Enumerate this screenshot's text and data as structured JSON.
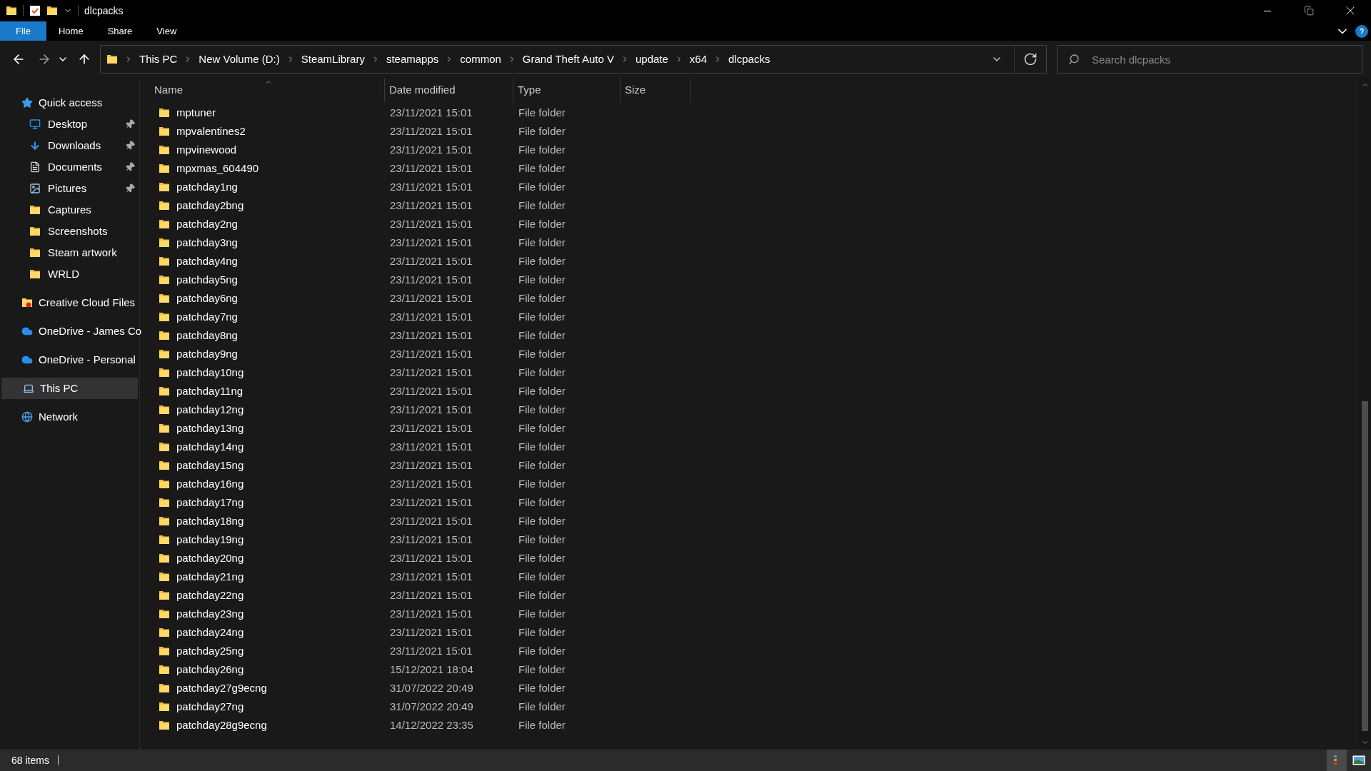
{
  "window": {
    "title": "dlcpacks"
  },
  "ribbon_tabs": [
    {
      "label": "File",
      "selected": true
    },
    {
      "label": "Home",
      "selected": false
    },
    {
      "label": "Share",
      "selected": false
    },
    {
      "label": "View",
      "selected": false
    }
  ],
  "breadcrumb": [
    "This PC",
    "New Volume (D:)",
    "SteamLibrary",
    "steamapps",
    "common",
    "Grand Theft Auto V",
    "update",
    "x64",
    "dlcpacks"
  ],
  "search": {
    "placeholder": "Search dlcpacks"
  },
  "sidebar": {
    "items": [
      {
        "label": "Quick access",
        "kind": "star",
        "selected": false,
        "children": [
          {
            "label": "Desktop",
            "kind": "desktop",
            "pinned": true
          },
          {
            "label": "Downloads",
            "kind": "download",
            "pinned": true
          },
          {
            "label": "Documents",
            "kind": "document",
            "pinned": true
          },
          {
            "label": "Pictures",
            "kind": "picture",
            "pinned": true
          },
          {
            "label": "Captures",
            "kind": "folder",
            "pinned": false
          },
          {
            "label": "Screenshots",
            "kind": "folder",
            "pinned": false
          },
          {
            "label": "Steam artwork",
            "kind": "folder",
            "pinned": false
          },
          {
            "label": "WRLD",
            "kind": "folder",
            "pinned": false
          }
        ]
      },
      {
        "label": "Creative Cloud Files",
        "kind": "cloud-folder",
        "selected": false
      },
      {
        "label": "OneDrive - James Co",
        "kind": "cloud",
        "selected": false
      },
      {
        "label": "OneDrive - Personal",
        "kind": "cloud",
        "selected": false
      },
      {
        "label": "This PC",
        "kind": "pc",
        "selected": true
      },
      {
        "label": "Network",
        "kind": "network",
        "selected": false
      }
    ]
  },
  "table": {
    "columns": [
      "Name",
      "Date modified",
      "Type",
      "Size"
    ],
    "rows": [
      {
        "name": "mptuner",
        "date": "23/11/2021 15:01",
        "type": "File folder"
      },
      {
        "name": "mpvalentines2",
        "date": "23/11/2021 15:01",
        "type": "File folder"
      },
      {
        "name": "mpvinewood",
        "date": "23/11/2021 15:01",
        "type": "File folder"
      },
      {
        "name": "mpxmas_604490",
        "date": "23/11/2021 15:01",
        "type": "File folder"
      },
      {
        "name": "patchday1ng",
        "date": "23/11/2021 15:01",
        "type": "File folder"
      },
      {
        "name": "patchday2bng",
        "date": "23/11/2021 15:01",
        "type": "File folder"
      },
      {
        "name": "patchday2ng",
        "date": "23/11/2021 15:01",
        "type": "File folder"
      },
      {
        "name": "patchday3ng",
        "date": "23/11/2021 15:01",
        "type": "File folder"
      },
      {
        "name": "patchday4ng",
        "date": "23/11/2021 15:01",
        "type": "File folder"
      },
      {
        "name": "patchday5ng",
        "date": "23/11/2021 15:01",
        "type": "File folder"
      },
      {
        "name": "patchday6ng",
        "date": "23/11/2021 15:01",
        "type": "File folder"
      },
      {
        "name": "patchday7ng",
        "date": "23/11/2021 15:01",
        "type": "File folder"
      },
      {
        "name": "patchday8ng",
        "date": "23/11/2021 15:01",
        "type": "File folder"
      },
      {
        "name": "patchday9ng",
        "date": "23/11/2021 15:01",
        "type": "File folder"
      },
      {
        "name": "patchday10ng",
        "date": "23/11/2021 15:01",
        "type": "File folder"
      },
      {
        "name": "patchday11ng",
        "date": "23/11/2021 15:01",
        "type": "File folder"
      },
      {
        "name": "patchday12ng",
        "date": "23/11/2021 15:01",
        "type": "File folder"
      },
      {
        "name": "patchday13ng",
        "date": "23/11/2021 15:01",
        "type": "File folder"
      },
      {
        "name": "patchday14ng",
        "date": "23/11/2021 15:01",
        "type": "File folder"
      },
      {
        "name": "patchday15ng",
        "date": "23/11/2021 15:01",
        "type": "File folder"
      },
      {
        "name": "patchday16ng",
        "date": "23/11/2021 15:01",
        "type": "File folder"
      },
      {
        "name": "patchday17ng",
        "date": "23/11/2021 15:01",
        "type": "File folder"
      },
      {
        "name": "patchday18ng",
        "date": "23/11/2021 15:01",
        "type": "File folder"
      },
      {
        "name": "patchday19ng",
        "date": "23/11/2021 15:01",
        "type": "File folder"
      },
      {
        "name": "patchday20ng",
        "date": "23/11/2021 15:01",
        "type": "File folder"
      },
      {
        "name": "patchday21ng",
        "date": "23/11/2021 15:01",
        "type": "File folder"
      },
      {
        "name": "patchday22ng",
        "date": "23/11/2021 15:01",
        "type": "File folder"
      },
      {
        "name": "patchday23ng",
        "date": "23/11/2021 15:01",
        "type": "File folder"
      },
      {
        "name": "patchday24ng",
        "date": "23/11/2021 15:01",
        "type": "File folder"
      },
      {
        "name": "patchday25ng",
        "date": "23/11/2021 15:01",
        "type": "File folder"
      },
      {
        "name": "patchday26ng",
        "date": "15/12/2021 18:04",
        "type": "File folder"
      },
      {
        "name": "patchday27g9ecng",
        "date": "31/07/2022 20:49",
        "type": "File folder"
      },
      {
        "name": "patchday27ng",
        "date": "31/07/2022 20:49",
        "type": "File folder"
      },
      {
        "name": "patchday28g9ecng",
        "date": "14/12/2022 23:35",
        "type": "File folder"
      }
    ]
  },
  "status_bar": {
    "count": "68 items"
  }
}
